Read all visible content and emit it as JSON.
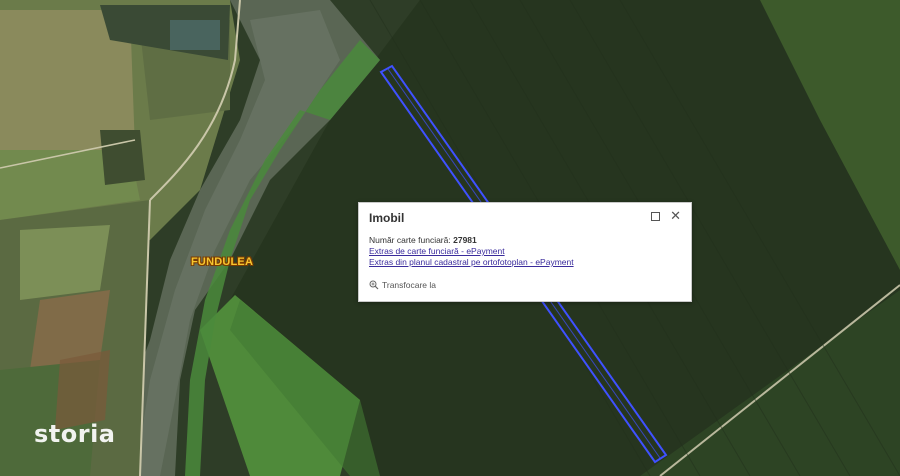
{
  "map": {
    "place_label": "FUNDULEA",
    "watermark": "storia"
  },
  "popup": {
    "title": "Imobil",
    "field_label": "Număr carte funciară:",
    "field_value": "27981",
    "links": [
      "Extras de carte funciară - ePayment",
      "Extras din planul cadastral pe ortofotoplan - ePayment"
    ],
    "zoom_label": "Transfocare la"
  },
  "colors": {
    "parcel_outline": "#3f51ff",
    "popup_link": "#3a2b9c",
    "place_label": "#f7c62f"
  },
  "icons": [
    "maximize-icon",
    "close-icon",
    "zoom-in-icon"
  ]
}
